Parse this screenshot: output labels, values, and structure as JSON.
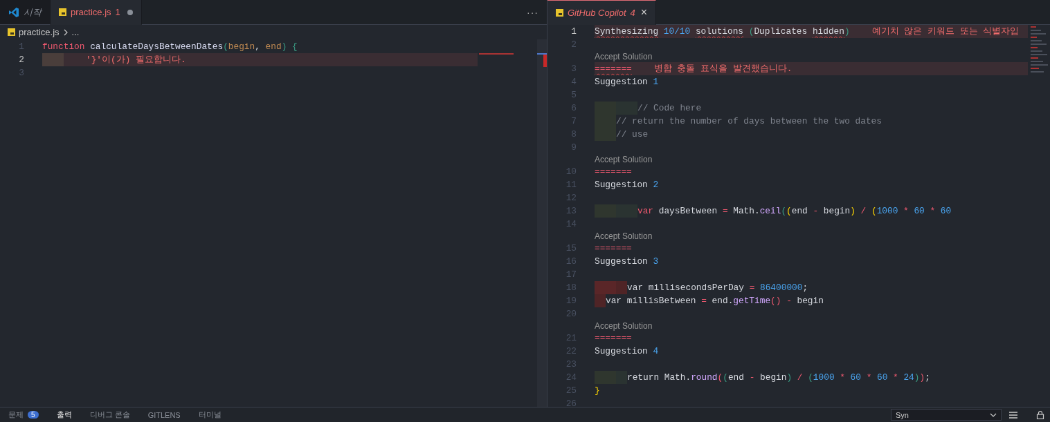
{
  "left_editor": {
    "tabs": [
      {
        "kind": "welcome",
        "label": "시작",
        "selected": false,
        "preview": true,
        "error": false,
        "dirty": false
      },
      {
        "kind": "file",
        "label": "practice.js",
        "badge": "1",
        "selected": true,
        "preview": false,
        "error": true,
        "dirty": true
      }
    ],
    "more": "···",
    "breadcrumb": {
      "file": "practice.js",
      "rest": "..."
    },
    "lines": [
      {
        "n": "1",
        "active": false,
        "error": false,
        "tokens": [
          {
            "kind": "kw",
            "text": "function "
          },
          {
            "kind": "fn",
            "text": "calculateDaysBetweenDates"
          },
          {
            "kind": "teal",
            "text": "("
          },
          {
            "kind": "param",
            "text": "begin"
          },
          {
            "kind": "plain",
            "text": ", "
          },
          {
            "kind": "param",
            "text": "end"
          },
          {
            "kind": "teal",
            "text": ") {"
          }
        ]
      },
      {
        "n": "2",
        "active": true,
        "error": true,
        "indent": [
          {
            "kind": "error-brown"
          }
        ],
        "diagnostic": "'}'이(가) 필요합니다."
      },
      {
        "n": "3",
        "active": false,
        "error": false
      }
    ]
  },
  "right_editor": {
    "tab": {
      "kind": "file",
      "label": "GitHub Copilot",
      "badge": "4",
      "close": "×",
      "selected": true,
      "preview": true,
      "error": true
    },
    "lines": [
      {
        "n": "1",
        "active": true,
        "error": true,
        "tokens": [
          {
            "kind": "warn",
            "text": "Synthesizing"
          },
          {
            "kind": "num",
            "text": " 10/10 "
          },
          {
            "kind": "warn",
            "text": "solutions"
          },
          {
            "kind": "teal",
            "text": " ("
          },
          {
            "kind": "plain",
            "text": "Duplicates "
          },
          {
            "kind": "warn",
            "text": "hidden"
          },
          {
            "kind": "teal",
            "text": ")"
          }
        ],
        "diagnostic": "예기치 않은 키워드 또는 식별자입"
      },
      {
        "n": "2",
        "active": false,
        "error": false
      },
      {
        "n": "3",
        "active": false,
        "error": true,
        "lens": "Accept Solution",
        "tokens": [
          {
            "kind": "conflict",
            "text": "======="
          }
        ],
        "diagnostic": "병합 충돌 표식을 발견했습니다."
      },
      {
        "n": "4",
        "active": false,
        "error": false,
        "tokens": [
          {
            "kind": "plain",
            "text": "Suggestion "
          },
          {
            "kind": "num",
            "text": "1"
          }
        ]
      },
      {
        "n": "5",
        "active": false,
        "error": false
      },
      {
        "n": "6",
        "active": false,
        "error": false,
        "indent": [
          {
            "kind": "tab"
          },
          {
            "kind": "tab-inner"
          }
        ],
        "tokens": [
          {
            "kind": "comment",
            "text": "// Code here"
          }
        ]
      },
      {
        "n": "7",
        "active": false,
        "error": false,
        "indent": [
          {
            "kind": "tab"
          }
        ],
        "tokens": [
          {
            "kind": "comment",
            "text": "// return the number of days between the two dates"
          }
        ]
      },
      {
        "n": "8",
        "active": false,
        "error": false,
        "indent": [
          {
            "kind": "tab"
          }
        ],
        "tokens": [
          {
            "kind": "comment",
            "text": "// use"
          }
        ]
      },
      {
        "n": "9",
        "active": false,
        "error": false
      },
      {
        "n": "10",
        "active": false,
        "error": false,
        "lens": "Accept Solution",
        "tokens": [
          {
            "kind": "conflict-plain",
            "text": "======="
          }
        ]
      },
      {
        "n": "11",
        "active": false,
        "error": false,
        "tokens": [
          {
            "kind": "plain",
            "text": "Suggestion "
          },
          {
            "kind": "num",
            "text": "2"
          }
        ]
      },
      {
        "n": "12",
        "active": false,
        "error": false
      },
      {
        "n": "13",
        "active": false,
        "error": false,
        "indent": [
          {
            "kind": "tab"
          },
          {
            "kind": "tab-inner"
          }
        ],
        "tokens": [
          {
            "kind": "kw",
            "text": "var"
          },
          {
            "kind": "plain",
            "text": " daysBetween "
          },
          {
            "kind": "op",
            "text": "="
          },
          {
            "kind": "plain",
            "text": " Math."
          },
          {
            "kind": "method",
            "text": "ceil"
          },
          {
            "kind": "teal",
            "text": "("
          },
          {
            "kind": "yellow",
            "text": "("
          },
          {
            "kind": "plain",
            "text": "end "
          },
          {
            "kind": "op",
            "text": "-"
          },
          {
            "kind": "plain",
            "text": " begin"
          },
          {
            "kind": "yellow",
            "text": ")"
          },
          {
            "kind": "op",
            "text": " / "
          },
          {
            "kind": "yellow",
            "text": "("
          },
          {
            "kind": "num",
            "text": "1000"
          },
          {
            "kind": "op",
            "text": " * "
          },
          {
            "kind": "num",
            "text": "60"
          },
          {
            "kind": "op",
            "text": " * "
          },
          {
            "kind": "num",
            "text": "60"
          }
        ]
      },
      {
        "n": "14",
        "active": false,
        "error": false
      },
      {
        "n": "15",
        "active": false,
        "error": false,
        "lens": "Accept Solution",
        "tokens": [
          {
            "kind": "conflict-plain",
            "text": "======="
          }
        ]
      },
      {
        "n": "16",
        "active": false,
        "error": false,
        "tokens": [
          {
            "kind": "plain",
            "text": "Suggestion "
          },
          {
            "kind": "num",
            "text": "3"
          }
        ]
      },
      {
        "n": "17",
        "active": false,
        "error": false
      },
      {
        "n": "18",
        "active": false,
        "error": false,
        "indent": [
          {
            "kind": "error-tab"
          },
          {
            "kind": "error-half"
          }
        ],
        "tokens": [
          {
            "kind": "plain",
            "text": "var millisecondsPerDay "
          },
          {
            "kind": "op",
            "text": "= "
          },
          {
            "kind": "num",
            "text": "86400000"
          },
          {
            "kind": "plain",
            "text": ";"
          }
        ]
      },
      {
        "n": "19",
        "active": false,
        "error": false,
        "indent": [
          {
            "kind": "error-half"
          }
        ],
        "tokens": [
          {
            "kind": "plain",
            "text": "var millisBetween "
          },
          {
            "kind": "op",
            "text": "="
          },
          {
            "kind": "plain",
            "text": " end."
          },
          {
            "kind": "method",
            "text": "getTime"
          },
          {
            "kind": "op",
            "text": "() - "
          },
          {
            "kind": "plain",
            "text": "begin"
          }
        ]
      },
      {
        "n": "20",
        "active": false,
        "error": false
      },
      {
        "n": "21",
        "active": false,
        "error": false,
        "lens": "Accept Solution",
        "tokens": [
          {
            "kind": "conflict-plain",
            "text": "======="
          }
        ]
      },
      {
        "n": "22",
        "active": false,
        "error": false,
        "tokens": [
          {
            "kind": "plain",
            "text": "Suggestion "
          },
          {
            "kind": "num",
            "text": "4"
          }
        ]
      },
      {
        "n": "23",
        "active": false,
        "error": false
      },
      {
        "n": "24",
        "active": false,
        "error": false,
        "indent": [
          {
            "kind": "tab"
          },
          {
            "kind": "half"
          }
        ],
        "tokens": [
          {
            "kind": "plain",
            "text": "return Math."
          },
          {
            "kind": "method",
            "text": "round"
          },
          {
            "kind": "op",
            "text": "("
          },
          {
            "kind": "teal",
            "text": "("
          },
          {
            "kind": "plain",
            "text": "end "
          },
          {
            "kind": "op",
            "text": "-"
          },
          {
            "kind": "plain",
            "text": " begin"
          },
          {
            "kind": "teal",
            "text": ")"
          },
          {
            "kind": "op",
            "text": " / "
          },
          {
            "kind": "teal",
            "text": "("
          },
          {
            "kind": "num",
            "text": "1000"
          },
          {
            "kind": "op",
            "text": " * "
          },
          {
            "kind": "num",
            "text": "60"
          },
          {
            "kind": "op",
            "text": " * "
          },
          {
            "kind": "num",
            "text": "60"
          },
          {
            "kind": "op",
            "text": " * "
          },
          {
            "kind": "num",
            "text": "24"
          },
          {
            "kind": "teal",
            "text": ")"
          },
          {
            "kind": "op",
            "text": ")"
          },
          {
            "kind": "plain",
            "text": ";"
          }
        ]
      },
      {
        "n": "25",
        "active": false,
        "error": false,
        "tokens": [
          {
            "kind": "yellow",
            "text": "}"
          }
        ]
      },
      {
        "n": "26",
        "active": false,
        "error": false
      }
    ]
  },
  "panel": {
    "tabs": [
      {
        "label": "문제",
        "badge": "5",
        "selected": false
      },
      {
        "label": "출력",
        "selected": true
      },
      {
        "label": "디버그 콘솔",
        "selected": false
      },
      {
        "label": "GITLENS",
        "selected": false
      },
      {
        "label": "터미널",
        "selected": false
      }
    ],
    "dropdown": {
      "value": "Syn"
    }
  }
}
